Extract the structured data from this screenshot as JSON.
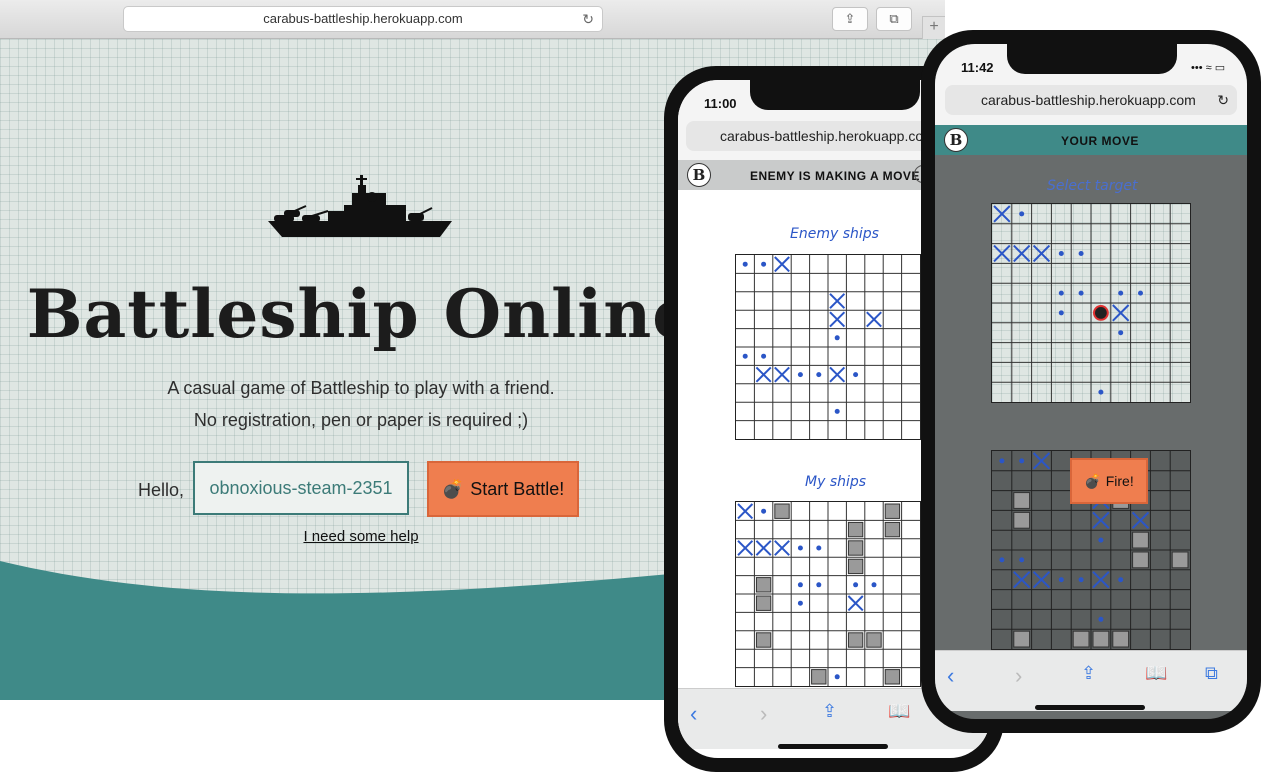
{
  "desktop": {
    "url": "carabus-battleship.herokuapp.com",
    "title": "Battleship Online",
    "tagline_1": "A casual game of Battleship to play with a friend.",
    "tagline_2": "No registration, pen or paper is required ;)",
    "hello_label": "Hello,",
    "player_name": "obnoxious-steam-2351",
    "start_button": "Start Battle!",
    "help_link": "I need some help",
    "colors": {
      "accent": "#ef7e4f",
      "teal": "#3f8a88",
      "grid_bg": "#dfe6e3"
    }
  },
  "phone1": {
    "time": "11:00",
    "url": "carabus-battleship.herokuapp.com",
    "logo": "B",
    "status": "ENEMY IS MAKING A MOVE",
    "enemy_board_label": "Enemy ships",
    "my_board_label": "My ships"
  },
  "phone2": {
    "time": "11:42",
    "url": "carabus-battleship.herokuapp.com",
    "logo": "B",
    "status": "YOUR MOVE",
    "target_board_label": "Select target",
    "fire_button": "Fire!"
  },
  "boards": {
    "p1_enemy": {
      "hits": [
        [
          0,
          2
        ],
        [
          2,
          5
        ],
        [
          3,
          5
        ],
        [
          3,
          7
        ],
        [
          6,
          1
        ],
        [
          6,
          2
        ],
        [
          6,
          5
        ]
      ],
      "misses": [
        [
          0,
          0
        ],
        [
          0,
          1
        ],
        [
          4,
          5
        ],
        [
          5,
          0
        ],
        [
          5,
          1
        ],
        [
          6,
          3
        ],
        [
          6,
          4
        ],
        [
          6,
          6
        ],
        [
          8,
          5
        ]
      ],
      "ships": []
    },
    "p1_mine": {
      "hits": [
        [
          0,
          0
        ],
        [
          2,
          0
        ],
        [
          2,
          1
        ],
        [
          2,
          2
        ],
        [
          5,
          6
        ]
      ],
      "misses": [
        [
          0,
          1
        ],
        [
          2,
          3
        ],
        [
          2,
          4
        ],
        [
          4,
          3
        ],
        [
          4,
          4
        ],
        [
          4,
          6
        ],
        [
          4,
          7
        ],
        [
          5,
          3
        ],
        [
          9,
          5
        ]
      ],
      "ships": [
        [
          0,
          2
        ],
        [
          0,
          8
        ],
        [
          1,
          6
        ],
        [
          1,
          8
        ],
        [
          2,
          6
        ],
        [
          3,
          6
        ],
        [
          4,
          1
        ],
        [
          5,
          1
        ],
        [
          7,
          1
        ],
        [
          7,
          6
        ],
        [
          7,
          7
        ],
        [
          9,
          4
        ],
        [
          9,
          8
        ]
      ]
    },
    "p2_target": {
      "hits": [
        [
          0,
          0
        ],
        [
          2,
          0
        ],
        [
          2,
          1
        ],
        [
          2,
          2
        ],
        [
          5,
          6
        ]
      ],
      "misses": [
        [
          0,
          1
        ],
        [
          2,
          3
        ],
        [
          2,
          4
        ],
        [
          4,
          3
        ],
        [
          4,
          4
        ],
        [
          4,
          6
        ],
        [
          4,
          7
        ],
        [
          5,
          3
        ],
        [
          6,
          6
        ],
        [
          9,
          5
        ]
      ],
      "target": [
        5,
        5
      ],
      "ships": []
    },
    "p2_mine": {
      "hits": [
        [
          0,
          2
        ],
        [
          2,
          5
        ],
        [
          3,
          5
        ],
        [
          3,
          7
        ],
        [
          6,
          1
        ],
        [
          6,
          2
        ],
        [
          6,
          5
        ]
      ],
      "misses": [
        [
          0,
          0
        ],
        [
          0,
          1
        ],
        [
          4,
          5
        ],
        [
          5,
          0
        ],
        [
          5,
          1
        ],
        [
          6,
          3
        ],
        [
          6,
          4
        ],
        [
          6,
          6
        ],
        [
          8,
          5
        ]
      ],
      "ships": [
        [
          2,
          1
        ],
        [
          3,
          1
        ],
        [
          2,
          6
        ],
        [
          4,
          7
        ],
        [
          5,
          7
        ],
        [
          5,
          9
        ],
        [
          9,
          1
        ],
        [
          9,
          4
        ],
        [
          9,
          5
        ],
        [
          9,
          6
        ]
      ]
    }
  }
}
